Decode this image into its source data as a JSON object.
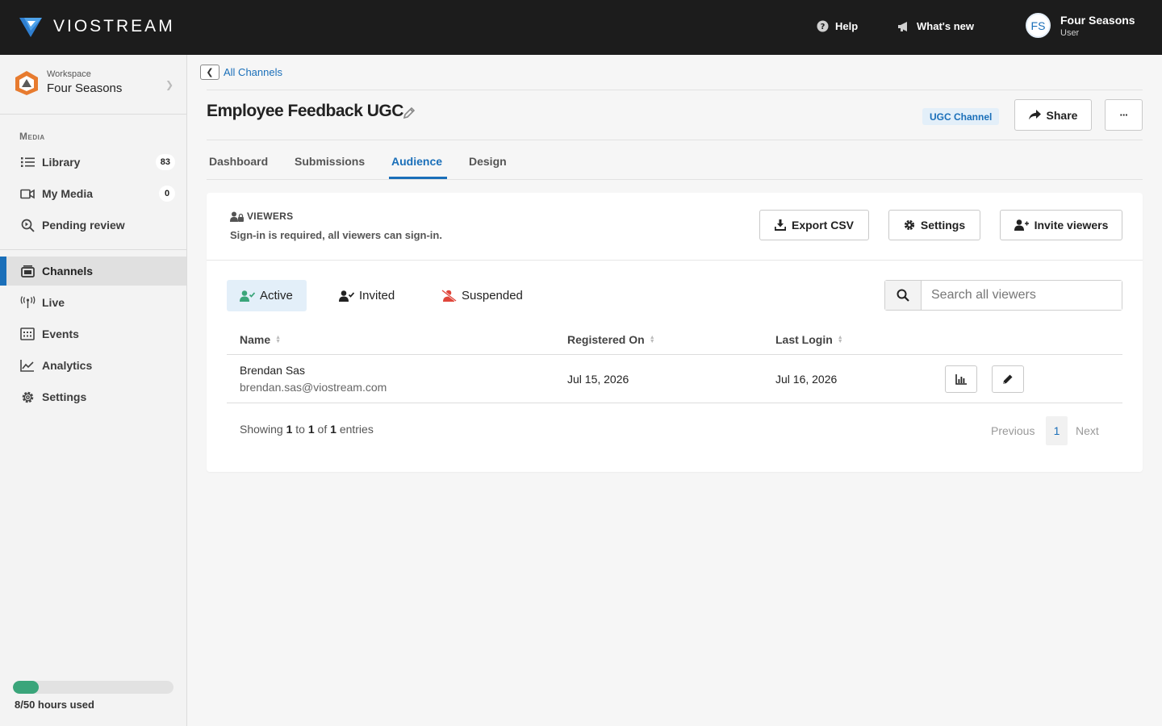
{
  "topbar": {
    "brand": "VIOSTREAM",
    "help": "Help",
    "whats_new": "What's new",
    "user_initials": "FS",
    "user_name": "Four Seasons",
    "user_role": "User"
  },
  "sidebar": {
    "workspace_label": "Workspace",
    "workspace_name": "Four Seasons",
    "section_media": "Media",
    "items": [
      {
        "label": "Library",
        "count": "83"
      },
      {
        "label": "My Media",
        "count": "0"
      },
      {
        "label": "Pending review"
      },
      {
        "label": "Channels"
      },
      {
        "label": "Live"
      },
      {
        "label": "Events"
      },
      {
        "label": "Analytics"
      },
      {
        "label": "Settings"
      }
    ],
    "usage_text": "8/50 hours used",
    "usage_fraction": 0.16
  },
  "breadcrumb": {
    "link": "All Channels"
  },
  "header": {
    "title": "Employee Feedback UGC",
    "badge": "UGC Channel",
    "share": "Share",
    "more": "···"
  },
  "tabs": [
    "Dashboard",
    "Submissions",
    "Audience",
    "Design"
  ],
  "viewers": {
    "title": "VIEWERS",
    "description": "Sign-in is required, all viewers can sign-in.",
    "export_csv": "Export CSV",
    "settings": "Settings",
    "invite": "Invite viewers"
  },
  "filters": [
    "Active",
    "Invited",
    "Suspended"
  ],
  "search": {
    "placeholder": "Search all viewers"
  },
  "table": {
    "columns": [
      "Name",
      "Registered On",
      "Last Login"
    ],
    "rows": [
      {
        "name": "Brendan Sas",
        "email": "brendan.sas@viostream.com",
        "registered": "Jul 15, 2026",
        "last_login": "Jul 16, 2026"
      }
    ]
  },
  "pagination": {
    "showing_prefix": "Showing",
    "from": "1",
    "to_word": "to",
    "to": "1",
    "of_word": "of",
    "total": "1",
    "suffix": "entries",
    "previous": "Previous",
    "current": "1",
    "next": "Next"
  },
  "colors": {
    "accent": "#1a6fb9",
    "topbar": "#1c1c1c",
    "usage": "#3aa57a",
    "suspended": "#e0463b",
    "active_filter_icon": "#3aa57a"
  }
}
